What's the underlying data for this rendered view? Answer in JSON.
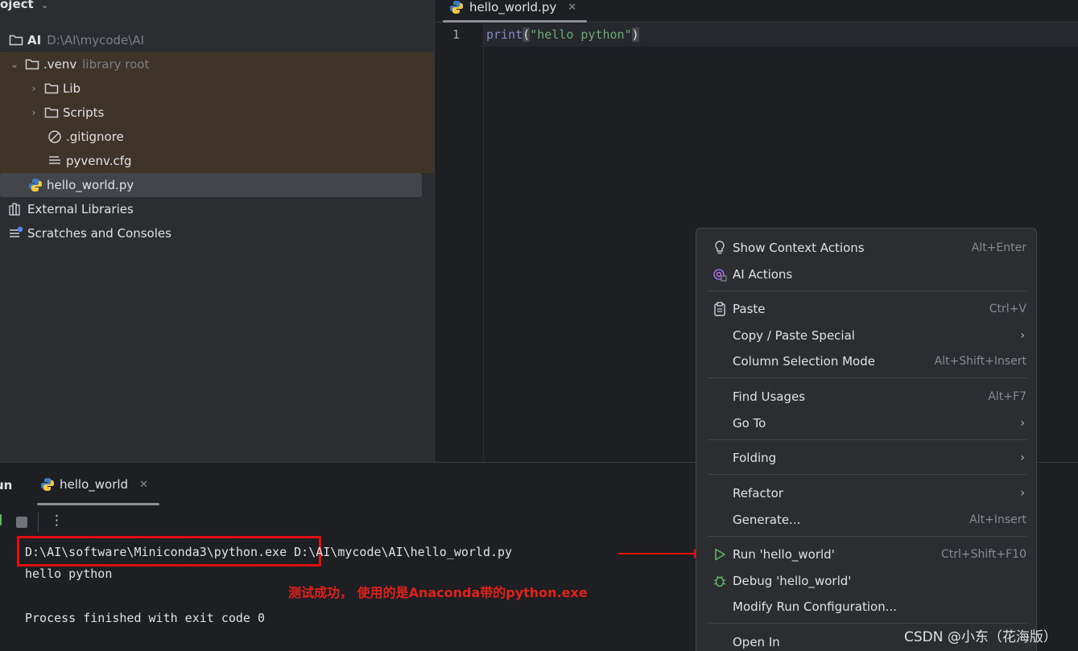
{
  "project": {
    "header": "oject",
    "items": [
      {
        "label": "AI",
        "hint": "D:\\AI\\mycode\\AI"
      },
      {
        "label": ".venv",
        "hint": "library root"
      },
      {
        "label": "Lib"
      },
      {
        "label": "Scripts"
      },
      {
        "label": ".gitignore"
      },
      {
        "label": "pyvenv.cfg"
      },
      {
        "label": "hello_world.py"
      },
      {
        "label": "External Libraries"
      },
      {
        "label": "Scratches and Consoles"
      }
    ]
  },
  "editor": {
    "tab": "hello_world.py",
    "line_number": "1",
    "code_fn": "print",
    "code_open": "(",
    "code_str": "\"hello python\"",
    "code_close": ")"
  },
  "run": {
    "title": "un",
    "tab": "hello_world",
    "console": {
      "exe_path": "D:\\AI\\software\\Miniconda3\\python.exe",
      "script_path": "D:\\AI\\mycode\\AI\\hello_world.py",
      "output": "hello python",
      "exit": "Process finished with exit code 0"
    },
    "annotation": "测试成功， 使用的是Anaconda带的python.exe"
  },
  "context_menu": {
    "items": [
      {
        "label": "Show Context Actions",
        "shortcut": "Alt+Enter"
      },
      {
        "label": "AI Actions",
        "shortcut": ""
      },
      {
        "label": "Paste",
        "shortcut": "Ctrl+V"
      },
      {
        "label": "Copy / Paste Special",
        "shortcut": ""
      },
      {
        "label": "Column Selection Mode",
        "shortcut": "Alt+Shift+Insert"
      },
      {
        "label": "Find Usages",
        "shortcut": "Alt+F7"
      },
      {
        "label": "Go To",
        "shortcut": ""
      },
      {
        "label": "Folding",
        "shortcut": ""
      },
      {
        "label": "Refactor",
        "shortcut": ""
      },
      {
        "label": "Generate...",
        "shortcut": "Alt+Insert"
      },
      {
        "label": "Run 'hello_world'",
        "shortcut": "Ctrl+Shift+F10"
      },
      {
        "label": "Debug 'hello_world'",
        "shortcut": ""
      },
      {
        "label": "Modify Run Configuration...",
        "shortcut": ""
      },
      {
        "label": "Open In",
        "shortcut": ""
      }
    ]
  },
  "watermark": "CSDN @小东（花海版）",
  "colors": {
    "accent_red": "#e01010",
    "run_green": "#5fb865",
    "ai_purple": "#9a6cf0"
  }
}
